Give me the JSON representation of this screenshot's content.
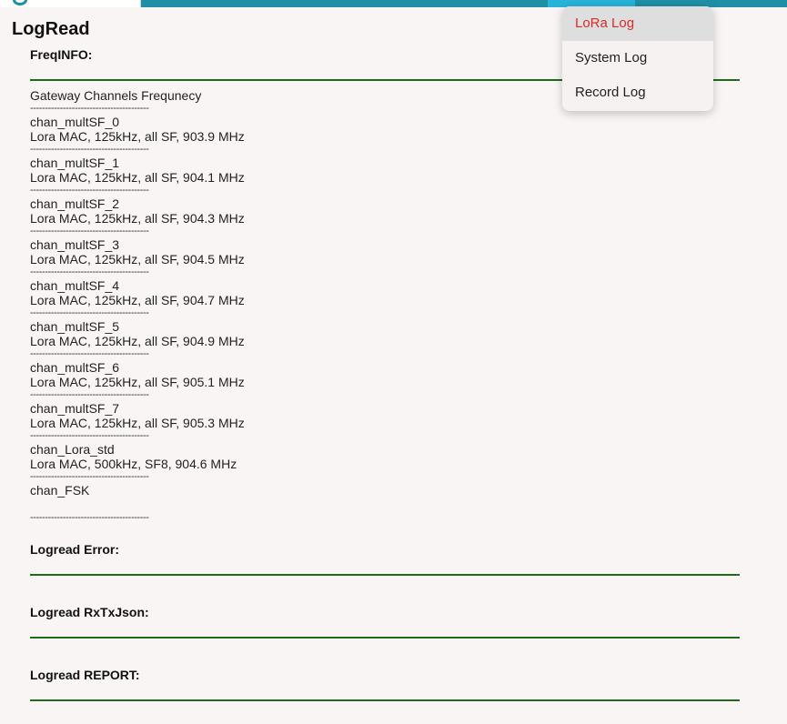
{
  "page": {
    "title": "LogRead"
  },
  "freq_info": {
    "heading": "FreqINFO:",
    "header_line": "Gateway Channels Frequnecy",
    "separator": "----------------------------------------",
    "channels": [
      {
        "name": "chan_multSF_0",
        "detail": "Lora MAC, 125kHz, all SF, 903.9 MHz"
      },
      {
        "name": "chan_multSF_1",
        "detail": "Lora MAC, 125kHz, all SF, 904.1 MHz"
      },
      {
        "name": "chan_multSF_2",
        "detail": "Lora MAC, 125kHz, all SF, 904.3 MHz"
      },
      {
        "name": "chan_multSF_3",
        "detail": "Lora MAC, 125kHz, all SF, 904.5 MHz"
      },
      {
        "name": "chan_multSF_4",
        "detail": "Lora MAC, 125kHz, all SF, 904.7 MHz"
      },
      {
        "name": "chan_multSF_5",
        "detail": "Lora MAC, 125kHz, all SF, 904.9 MHz"
      },
      {
        "name": "chan_multSF_6",
        "detail": "Lora MAC, 125kHz, all SF, 905.1 MHz"
      },
      {
        "name": "chan_multSF_7",
        "detail": "Lora MAC, 125kHz, all SF, 905.3 MHz"
      },
      {
        "name": "chan_Lora_std",
        "detail": "Lora MAC, 500kHz, SF8, 904.6 MHz"
      },
      {
        "name": "chan_FSK",
        "detail": ""
      }
    ]
  },
  "sections": {
    "error": "Logread Error:",
    "rxtxjson": "Logread RxTxJson:",
    "report": "Logread REPORT:"
  },
  "menu": {
    "items": [
      "LoRa Log",
      "System Log",
      "Record Log"
    ],
    "active_color": "#d92b2b"
  },
  "colors": {
    "rule": "#1e6b1e",
    "topbar": "#1f8fa5"
  }
}
